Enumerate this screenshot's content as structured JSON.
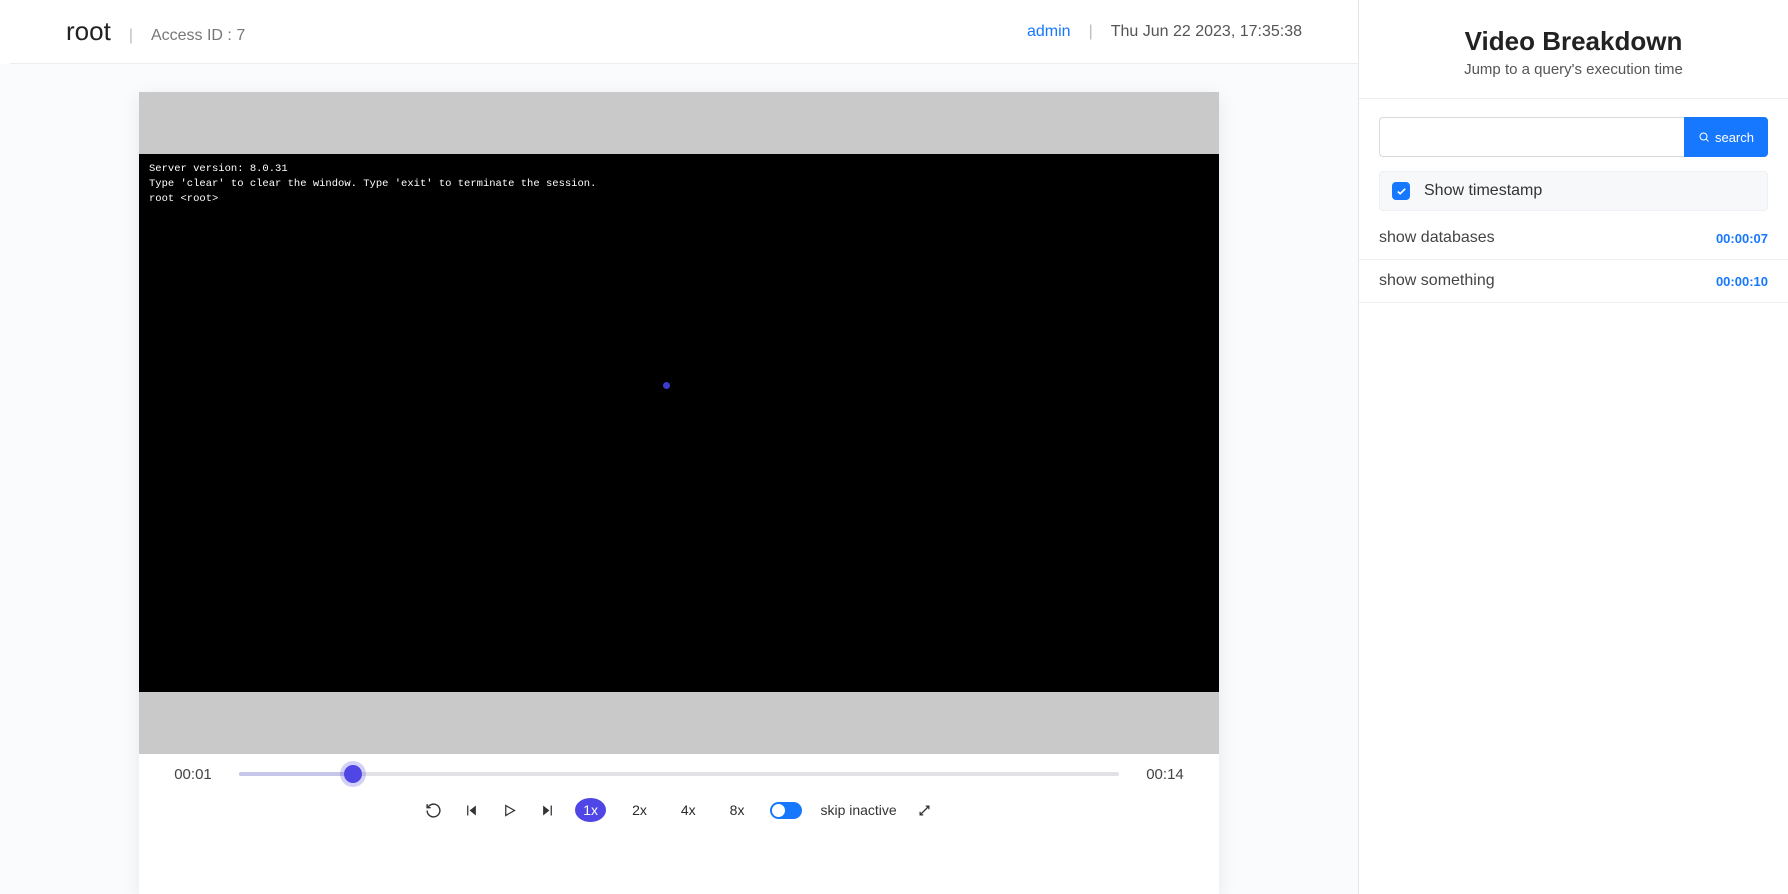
{
  "header": {
    "title": "root",
    "access_label": "Access ID : 7",
    "user": "admin",
    "datetime": "Thu Jun 22 2023, 17:35:38"
  },
  "terminal": {
    "line1": "Server version: 8.0.31",
    "line2": "Type 'clear' to clear the window. Type 'exit' to terminate the session.",
    "line3": "root <root>"
  },
  "player": {
    "current_time": "00:01",
    "total_time": "00:14",
    "progress_pct": 13,
    "speeds": {
      "s1": "1x",
      "s2": "2x",
      "s4": "4x",
      "s8": "8x"
    },
    "skip_label": "skip inactive"
  },
  "sidebar": {
    "title": "Video Breakdown",
    "subtitle": "Jump to a query's execution time",
    "search_button": "search",
    "checkbox_label": "Show timestamp",
    "queries": [
      {
        "text": "show databases",
        "time": "00:00:07"
      },
      {
        "text": "show something",
        "time": "00:00:10"
      }
    ]
  }
}
